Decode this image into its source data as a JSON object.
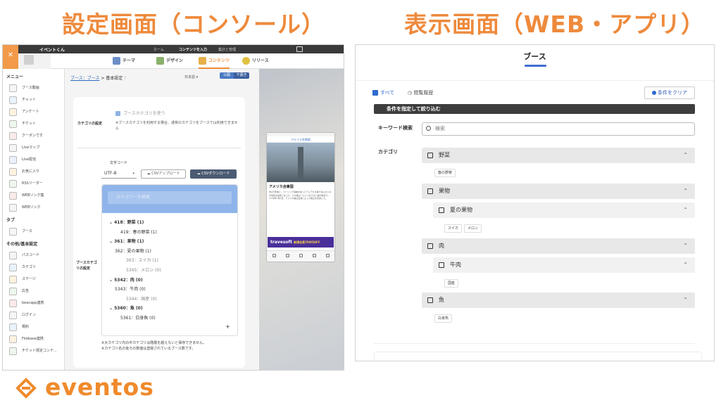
{
  "headings": {
    "left": "設定画面（コンソール）",
    "right": "表示画面（WEB・アプリ）"
  },
  "admin": {
    "app_name": "イベントくん",
    "top_links": [
      "ホーム",
      "コンテンツを入力",
      "集計と管理"
    ],
    "tabs": [
      "テーマ",
      "デザイン",
      "コンテンツ",
      "リリース"
    ],
    "sidebar": {
      "menu_title": "メニュー",
      "menu_items": [
        "ブース動画",
        "チャット",
        "アンケート",
        "チケット",
        "クーポンです",
        "Liveマップ",
        "Live配信",
        "お気に入り",
        "RSSリーダー",
        "WEBリンク集",
        "WEBリンク"
      ],
      "tab_title": "タブ",
      "tab_items": [
        "ブース"
      ],
      "other_title": "その他/基本設定",
      "other_items": [
        "パスコード",
        "カテゴリ",
        "ステージ",
        "広告",
        "beacapp連携",
        "ログイン",
        "規約",
        "Firebase連携",
        "チケット限定コンテ..."
      ]
    },
    "breadcrumb": {
      "link": "ブース：ブース",
      "current": "> 基本設定",
      "help": "?"
    },
    "language": "日本語",
    "publish_label": "公開",
    "draft_label": "下書き",
    "category_setting_label": "カテゴリの設定",
    "use_booth_category": "ブースカテゴリを使う",
    "category_note": "※ブースカテゴリを利用する場合、通常のカテゴリをブースでは利用できません",
    "encoding_label": "文字コード",
    "encoding_value": "UTF-8",
    "csv_upload": "CSVアップロード",
    "csv_download": "CSVダウンロード",
    "tree_search_placeholder": "カテゴリーを検索",
    "tree": [
      {
        "text": "418：野菜 (1)",
        "bold": true
      },
      {
        "text": "419：春の野菜 (1)",
        "bold": false
      },
      {
        "text": "361：果物 (1)",
        "bold": true
      },
      {
        "text": "362：夏の果物 (1)",
        "bold": false
      },
      {
        "text": "363：スイカ (1)",
        "bold": false
      },
      {
        "text": "5345：メロン (0)",
        "bold": false
      },
      {
        "text": "5342：肉 (0)",
        "bold": true
      },
      {
        "text": "5343：牛肉 (0)",
        "bold": false
      },
      {
        "text": "5344：国産 (0)",
        "bold": false
      },
      {
        "text": "5360：魚 (0)",
        "bold": true
      },
      {
        "text": "5361：白身魚 (0)",
        "bold": false
      }
    ],
    "tree_add": "+",
    "booth_category_label": "ブースカテゴリの設定",
    "footnote": "※大カテゴリ内の中カテゴリは階層を越えないと保存できません。\n※カテゴリ名の後ろの数値は登録されているブース数です。",
    "preview": {
      "title": "アメリカ合衆国",
      "heading": "アメリカ合衆国",
      "body": "約1万年前に、ベーリング海峡を渡ってアジアから移り住んだ人々が最初の住民となった。その後ヨーロッパからの入植が始まり、1776年7月4日、アメリカ独立宣言によって独立を宣言した。",
      "ad_brand": "travesoft",
      "ad_text": "新規会員700円OFF"
    }
  },
  "web": {
    "title": "ブース",
    "tab_all": "すべて",
    "tab_history": "閲覧履歴",
    "clear_button": "条件をクリア",
    "filter_bar": "条件を指定して絞り込む",
    "keyword_label": "キーワード検索",
    "search_placeholder": "検索",
    "category_label": "カテゴリ",
    "categories": {
      "vegetables": "野菜",
      "spring_veg": "春の野菜",
      "fruit": "果物",
      "summer_fruit": "夏の果物",
      "watermelon": "スイカ",
      "melon": "メロン",
      "meat": "肉",
      "beef": "牛肉",
      "domestic": "国産",
      "fish": "魚",
      "white_fish": "白身魚"
    }
  },
  "logo": {
    "text": "eventos"
  },
  "colors": {
    "accent_orange": "#ee8a3c",
    "brand_blue": "#3f6fcf"
  }
}
